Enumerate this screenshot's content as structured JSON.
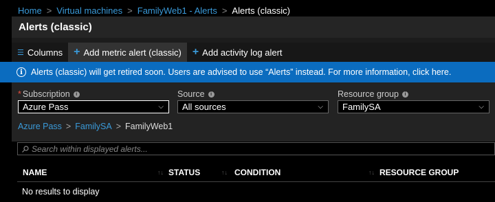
{
  "breadcrumb": [
    "Home",
    "Virtual machines",
    "FamilyWeb1 - Alerts",
    "Alerts (classic)"
  ],
  "blade_title": "Alerts (classic)",
  "toolbar": {
    "columns_label": "Columns",
    "add_metric_label": "Add metric alert (classic)",
    "add_activity_label": "Add activity log alert"
  },
  "banner": {
    "text": "Alerts (classic) will get retired soon. Users are advised to use “Alerts” instead. For more information, click here."
  },
  "filters": {
    "subscription": {
      "label": "Subscription",
      "value": "Azure Pass"
    },
    "source": {
      "label": "Source",
      "value": "All sources"
    },
    "resource_group": {
      "label": "Resource group",
      "value": "FamilySA"
    }
  },
  "scope_crumb": [
    "Azure Pass",
    "FamilySA",
    "FamilyWeb1"
  ],
  "search": {
    "placeholder": "Search within displayed alerts..."
  },
  "table": {
    "columns": [
      "NAME",
      "STATUS",
      "CONDITION",
      "RESOURCE GROUP"
    ],
    "empty_text": "No results to display"
  },
  "colors": {
    "accent": "#3a9ad9",
    "banner": "#0b6cbf"
  }
}
